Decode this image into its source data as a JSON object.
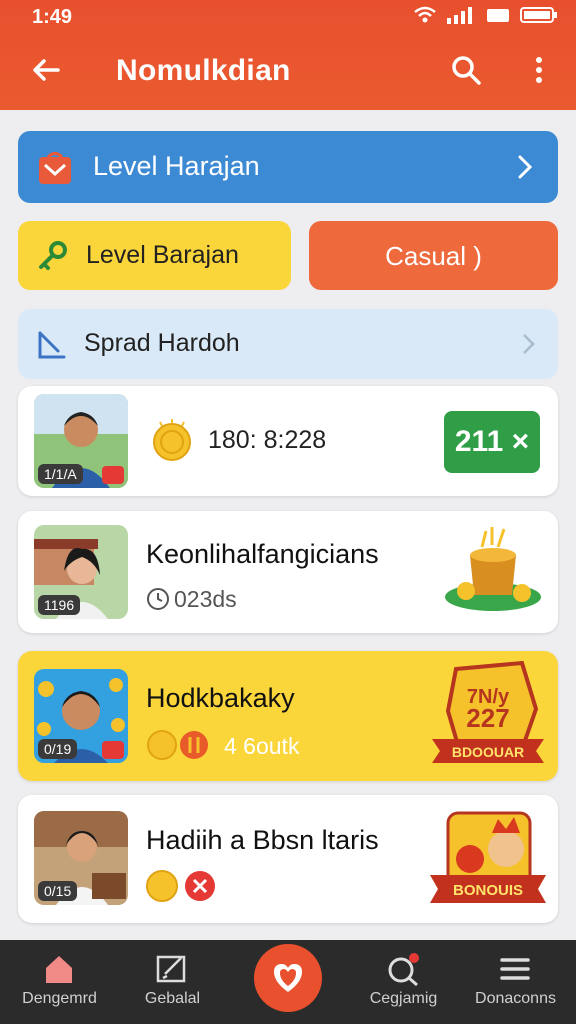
{
  "status": {
    "time": "1:49"
  },
  "appbar": {
    "title": "Nomulkdian"
  },
  "filters": {
    "level_harajan": "Level Harajan",
    "level_barajan": "Level Barajan",
    "casual": "Casual )",
    "spread": "Sprad Hardoh"
  },
  "items": [
    {
      "badge": "1/1/A",
      "title": "",
      "value": "180: 8:228",
      "pill": "211 ×"
    },
    {
      "badge": "1196",
      "title": "Keonlihalfangicians",
      "sub": "023ds"
    },
    {
      "badge": "0/19",
      "title": "Hodkbakaky",
      "sub": "4 6outk",
      "promo_top": "7N/y",
      "promo_mid": "227",
      "promo_banner": "BDOOUAR"
    },
    {
      "badge": "0/15",
      "title": "Hadiih  a Bbsn ltaris",
      "promo_banner": "BONOUIS"
    }
  ],
  "nav": {
    "home": "Dengemrd",
    "social": "Gebalal",
    "search": "Cegjamig",
    "more": "Donaconns"
  },
  "colors": {
    "primary": "#e8502d",
    "blue": "#3d8ad4",
    "yellow": "#fbd63a",
    "green": "#2f9e46",
    "nav": "#2b2b2b"
  }
}
